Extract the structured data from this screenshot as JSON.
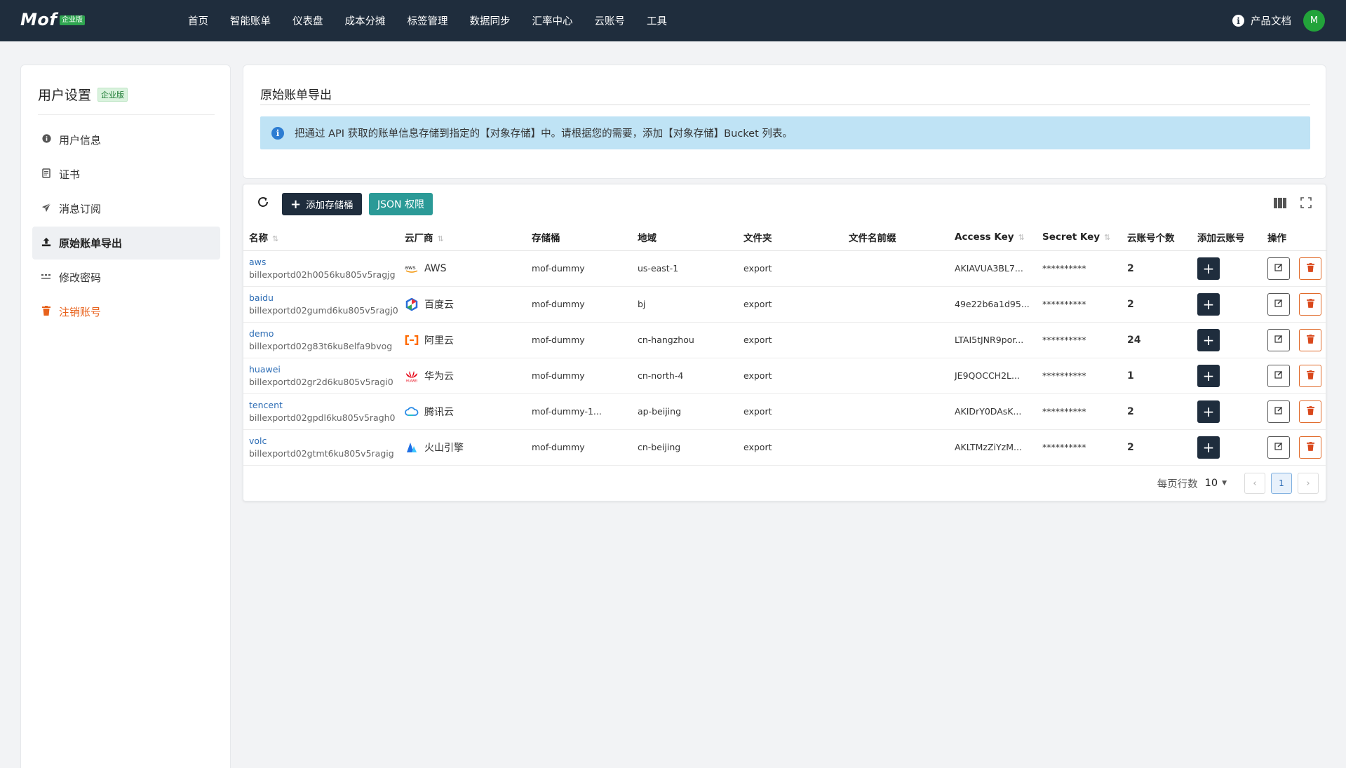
{
  "app": {
    "logo": "Mof",
    "logo_badge": "企业版"
  },
  "nav": [
    "首页",
    "智能账单",
    "仪表盘",
    "成本分摊",
    "标签管理",
    "数据同步",
    "汇率中心",
    "云账号",
    "工具"
  ],
  "top_right": {
    "info_icon": "i",
    "docs_label": "产品文档",
    "avatar_initial": "M"
  },
  "sidebar": {
    "title": "用户设置",
    "badge": "企业版",
    "items": [
      {
        "label": "用户信息",
        "icon": "info-circle-icon"
      },
      {
        "label": "证书",
        "icon": "certificate-icon"
      },
      {
        "label": "消息订阅",
        "icon": "paper-plane-icon"
      },
      {
        "label": "原始账单导出",
        "icon": "upload-icon"
      },
      {
        "label": "修改密码",
        "icon": "password-dots-icon"
      },
      {
        "label": "注销账号",
        "icon": "trash-icon"
      }
    ]
  },
  "header": {
    "title": "原始账单导出",
    "notice": "把通过 API 获取的账单信息存储到指定的【对象存储】中。请根据您的需要，添加【对象存储】Bucket 列表。"
  },
  "toolbar": {
    "add_bucket_label": "添加存储桶",
    "json_label": "JSON 权限"
  },
  "table": {
    "columns": [
      "名称",
      "云厂商",
      "存储桶",
      "地域",
      "文件夹",
      "文件名前缀",
      "Access Key",
      "Secret Key",
      "云账号个数",
      "添加云账号",
      "操作"
    ],
    "rows": [
      {
        "name": "aws",
        "id": "billexportd02h0056ku805v5ragjg",
        "vendor": "AWS",
        "vendor_icon": "aws-logo-icon",
        "bucket": "mof-dummy",
        "region": "us-east-1",
        "folder": "export",
        "prefix": "",
        "access_key": "AKIAVUA3BL7...",
        "secret_key": "**********",
        "count": "2"
      },
      {
        "name": "baidu",
        "id": "billexportd02gumd6ku805v5ragj0",
        "vendor": "百度云",
        "vendor_icon": "baidu-cloud-logo-icon",
        "bucket": "mof-dummy",
        "region": "bj",
        "folder": "export",
        "prefix": "",
        "access_key": "49e22b6a1d95...",
        "secret_key": "**********",
        "count": "2"
      },
      {
        "name": "demo",
        "id": "billexportd02g83t6ku8elfa9bvog",
        "vendor": "阿里云",
        "vendor_icon": "aliyun-logo-icon",
        "bucket": "mof-dummy",
        "region": "cn-hangzhou",
        "folder": "export",
        "prefix": "",
        "access_key": "LTAI5tJNR9por...",
        "secret_key": "**********",
        "count": "24"
      },
      {
        "name": "huawei",
        "id": "billexportd02gr2d6ku805v5ragi0",
        "vendor": "华为云",
        "vendor_icon": "huawei-logo-icon",
        "bucket": "mof-dummy",
        "region": "cn-north-4",
        "folder": "export",
        "prefix": "",
        "access_key": "JE9QOCCH2L...",
        "secret_key": "**********",
        "count": "1"
      },
      {
        "name": "tencent",
        "id": "billexportd02gpdl6ku805v5ragh0",
        "vendor": "腾讯云",
        "vendor_icon": "tencent-cloud-logo-icon",
        "bucket": "mof-dummy-1...",
        "region": "ap-beijing",
        "folder": "export",
        "prefix": "",
        "access_key": "AKIDrY0DAsK...",
        "secret_key": "**********",
        "count": "2"
      },
      {
        "name": "volc",
        "id": "billexportd02gtmt6ku805v5ragig",
        "vendor": "火山引擎",
        "vendor_icon": "volcengine-logo-icon",
        "bucket": "mof-dummy",
        "region": "cn-beijing",
        "folder": "export",
        "prefix": "",
        "access_key": "AKLTMzZiYzM...",
        "secret_key": "**********",
        "count": "2"
      }
    ]
  },
  "pagination": {
    "rows_per_page_label": "每页行数",
    "rows_per_page": "10",
    "current_page": "1"
  },
  "colors": {
    "topbar": "#1f2d3d",
    "primary_button": "#1f2d3d",
    "json_button": "#2b9a97",
    "notice_bg": "#bfe3f5",
    "danger": "#e8621c",
    "link": "#2d6db5",
    "badge_green": "#2ea44f"
  }
}
